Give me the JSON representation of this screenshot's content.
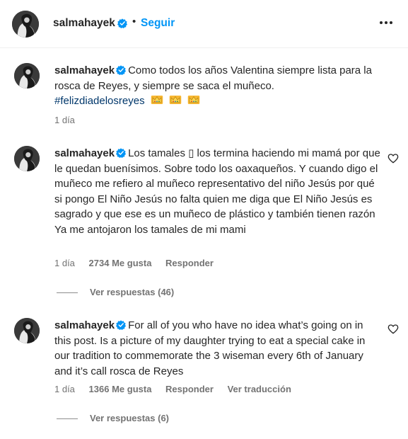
{
  "header": {
    "username": "salmahayek",
    "separator": "•",
    "follow_label": "Seguir",
    "avatar_icon": "profile-photo",
    "more_icon": "more-options-icon"
  },
  "colors": {
    "link_blue": "#0095f6",
    "hashtag": "#00376b",
    "verified_blue": "#0095f6",
    "secondary_text": "#737373"
  },
  "caption": {
    "username": "salmahayek",
    "text": "Como todos los años Valentina siempre lista para la rosca de Reyes, y siempre se saca el muñeco.",
    "hashtag": "#felizdiadelosreyes",
    "emoji": "crown-emoji x3",
    "time": "1 día"
  },
  "comments": [
    {
      "username": "salmahayek",
      "text": "Los tamales ▯ los termina haciendo mi mamá por que le quedan buenísimos. Sobre todo los oaxaqueños. Y cuando digo el muñeco me refiero al muñeco representativo del niño Jesús por qué si pongo El Niño Jesús no falta quien me diga que El Niño Jesús es sagrado y que ese es un muñeco de plástico y también tienen razón Ya me antojaron los tamales de mi mami",
      "time": "1 día",
      "likes": "2734 Me gusta",
      "reply_label": "Responder",
      "view_replies": "Ver respuestas (46)"
    },
    {
      "username": "salmahayek",
      "text": "For all of you who have no idea what’s going on in this post. Is a picture of my daughter trying to eat a special cake in our tradition to commemorate the 3 wiseman every 6th of January and it’s call rosca de Reyes",
      "time": "1 día",
      "likes": "1366 Me gusta",
      "reply_label": "Responder",
      "translate_label": "Ver traducción",
      "view_replies": "Ver respuestas (6)"
    }
  ]
}
